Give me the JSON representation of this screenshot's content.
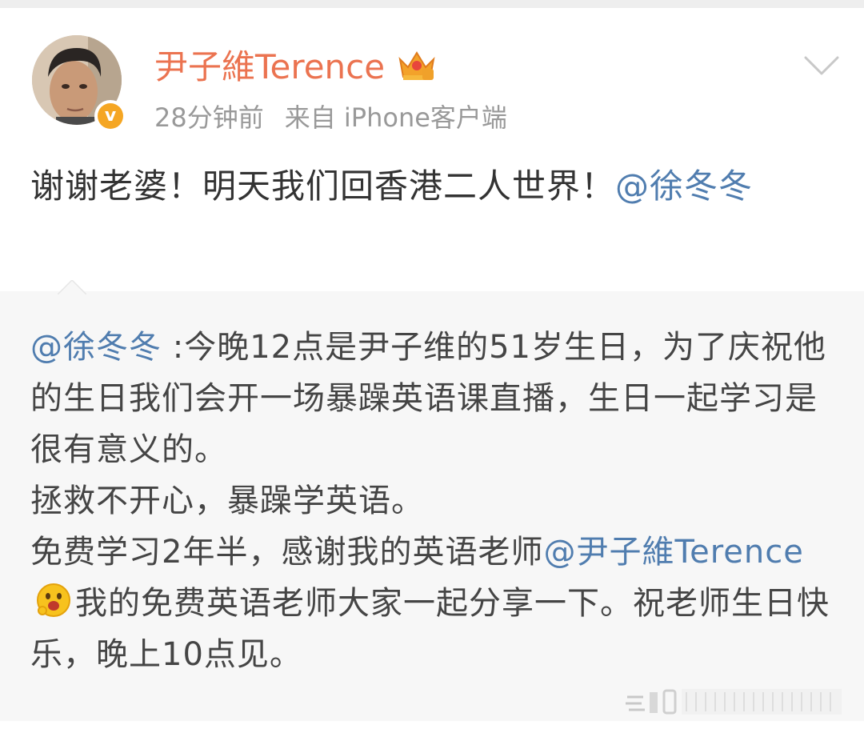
{
  "post": {
    "user_name": "尹子維Terence",
    "time": "28分钟前",
    "source": "来自 iPhone客户端",
    "text": "谢谢老婆！明天我们回香港二人世界！",
    "mention": "@徐冬冬",
    "verified_mark": "v"
  },
  "quote": {
    "author_mention": "@徐冬冬",
    "text_1": " :今晚12点是尹子维的51岁生日，为了庆祝他的生日我们会开一场暴躁英语课直播，生日一起学习是很有意义的。",
    "text_2": "拯救不开心，暴躁学英语。",
    "text_3": "免费学习2年半，感谢我的英语老师",
    "teacher_mention": "@尹子維Terence",
    "text_4": "我的免费英语老师大家一起分享一下。祝老师生日快乐，晚上10点见。"
  },
  "icons": {
    "avatar": "user-avatar",
    "verified": "verified-badge-icon",
    "crown": "crown-icon",
    "more": "chevron-down-icon",
    "emoji": "excited-face-emoji-icon"
  },
  "colors": {
    "name": "#eb7350",
    "mention": "#507daf",
    "meta": "#999999",
    "quote_bg": "#f7f7f7"
  }
}
